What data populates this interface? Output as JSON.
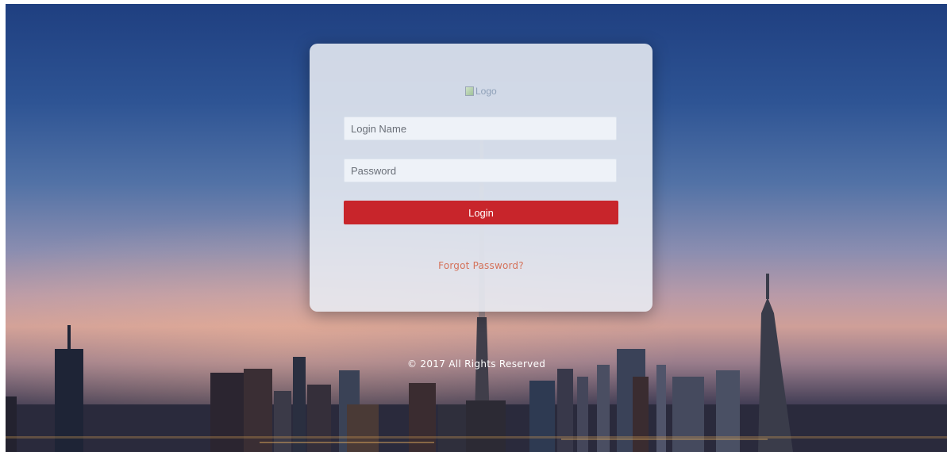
{
  "logo": {
    "alt_text": "Logo"
  },
  "login_form": {
    "login_name_placeholder": "Login Name",
    "password_placeholder": "Password",
    "login_button_label": "Login",
    "forgot_password_link": "Forgot Password?"
  },
  "footer": {
    "copyright": "© 2017 All Rights Reserved"
  },
  "colors": {
    "login_button": "#c8252b",
    "forgot_link": "#d4725a",
    "card_background": "#e8ecf2"
  }
}
